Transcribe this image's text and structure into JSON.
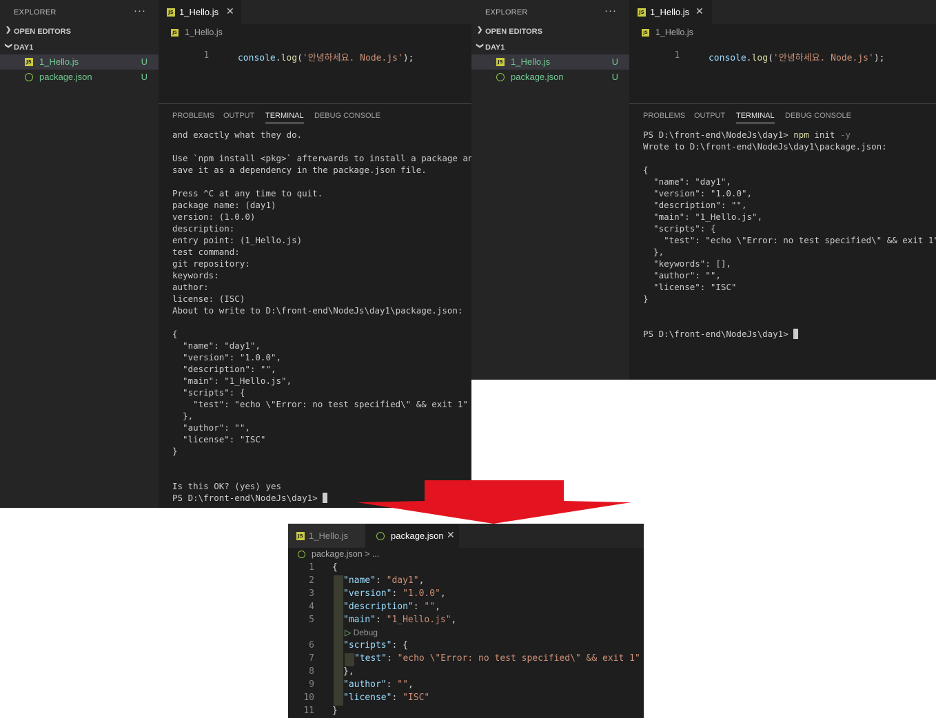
{
  "left": {
    "explorer": {
      "title": "EXPLORER",
      "more": "···",
      "open_editors": "OPEN EDITORS",
      "folder": "DAY1",
      "files": [
        {
          "name": "1_Hello.js",
          "status": "U"
        },
        {
          "name": "package.json",
          "status": "U"
        }
      ]
    },
    "editor": {
      "tab": "1_Hello.js",
      "breadcrumb": "1_Hello.js",
      "line_no": "1",
      "code": {
        "obj": "console",
        "dot": ".",
        "fn": "log",
        "open": "(",
        "str": "'안녕하세요. Node.js'",
        "close": ");"
      }
    },
    "panel": {
      "tabs": [
        "PROBLEMS",
        "OUTPUT",
        "TERMINAL",
        "DEBUG CONSOLE"
      ],
      "terminal": [
        "and exactly what they do.",
        "",
        "Use `npm install <pkg>` afterwards to install a package and",
        "save it as a dependency in the package.json file.",
        "",
        "Press ^C at any time to quit.",
        "package name: (day1)",
        "version: (1.0.0)",
        "description:",
        "entry point: (1_Hello.js)",
        "test command:",
        "git repository:",
        "keywords:",
        "author:",
        "license: (ISC)",
        "About to write to D:\\front-end\\NodeJs\\day1\\package.json:",
        "",
        "{",
        "  \"name\": \"day1\",",
        "  \"version\": \"1.0.0\",",
        "  \"description\": \"\",",
        "  \"main\": \"1_Hello.js\",",
        "  \"scripts\": {",
        "    \"test\": \"echo \\\"Error: no test specified\\\" && exit 1\"",
        "  },",
        "  \"author\": \"\",",
        "  \"license\": \"ISC\"",
        "}",
        "",
        "",
        "Is this OK? (yes) yes"
      ],
      "prompt": "PS D:\\front-end\\NodeJs\\day1> "
    }
  },
  "right": {
    "explorer": {
      "title": "EXPLORER",
      "more": "···",
      "open_editors": "OPEN EDITORS",
      "folder": "DAY1",
      "files": [
        {
          "name": "1_Hello.js",
          "status": "U"
        },
        {
          "name": "package.json",
          "status": "U"
        }
      ]
    },
    "editor": {
      "tab": "1_Hello.js",
      "breadcrumb": "1_Hello.js",
      "line_no": "1",
      "code": {
        "obj": "console",
        "dot": ".",
        "fn": "log",
        "open": "(",
        "str": "'안녕하세요. Node.js'",
        "close": ");"
      }
    },
    "panel": {
      "tabs": [
        "PROBLEMS",
        "OUTPUT",
        "TERMINAL",
        "DEBUG CONSOLE"
      ],
      "cmd_prompt": "PS D:\\front-end\\NodeJs\\day1> ",
      "cmd_npm": "npm",
      "cmd_init": " init ",
      "cmd_flag": "-y",
      "terminal": [
        "Wrote to D:\\front-end\\NodeJs\\day1\\package.json:",
        "",
        "{",
        "  \"name\": \"day1\",",
        "  \"version\": \"1.0.0\",",
        "  \"description\": \"\",",
        "  \"main\": \"1_Hello.js\",",
        "  \"scripts\": {",
        "    \"test\": \"echo \\\"Error: no test specified\\\" && exit 1\"",
        "  },",
        "  \"keywords\": [],",
        "  \"author\": \"\",",
        "  \"license\": \"ISC\"",
        "}",
        "",
        ""
      ],
      "prompt": "PS D:\\front-end\\NodeJs\\day1> "
    }
  },
  "bottom": {
    "tabs": [
      {
        "name": "1_Hello.js"
      },
      {
        "name": "package.json"
      }
    ],
    "close": "✕",
    "breadcrumb": "package.json > ...",
    "debug_lens": "Debug",
    "lines": [
      {
        "n": "1",
        "key": "",
        "sep": "",
        "val": "",
        "tail": "{"
      },
      {
        "n": "2",
        "key": "\"name\"",
        "sep": ": ",
        "val": "\"day1\"",
        "tail": ","
      },
      {
        "n": "3",
        "key": "\"version\"",
        "sep": ": ",
        "val": "\"1.0.0\"",
        "tail": ","
      },
      {
        "n": "4",
        "key": "\"description\"",
        "sep": ": ",
        "val": "\"\"",
        "tail": ","
      },
      {
        "n": "5",
        "key": "\"main\"",
        "sep": ": ",
        "val": "\"1_Hello.js\"",
        "tail": ","
      },
      {
        "n": "6",
        "key": "\"scripts\"",
        "sep": ": ",
        "val": "",
        "tail": "{"
      },
      {
        "n": "7",
        "key": "\"test\"",
        "sep": ": ",
        "val": "\"echo \\\"Error: no test specified\\\" && exit 1\"",
        "tail": ""
      },
      {
        "n": "8",
        "key": "",
        "sep": "",
        "val": "",
        "tail": "},"
      },
      {
        "n": "9",
        "key": "\"author\"",
        "sep": ": ",
        "val": "\"\"",
        "tail": ","
      },
      {
        "n": "10",
        "key": "\"license\"",
        "sep": ": ",
        "val": "\"ISC\"",
        "tail": ""
      },
      {
        "n": "11",
        "key": "",
        "sep": "",
        "val": "",
        "tail": "}"
      }
    ]
  },
  "colors": {
    "arrow": "#e3141f",
    "untracked": "#73c991",
    "editor_bg": "#1e1e1e",
    "sidebar_bg": "#252526"
  }
}
